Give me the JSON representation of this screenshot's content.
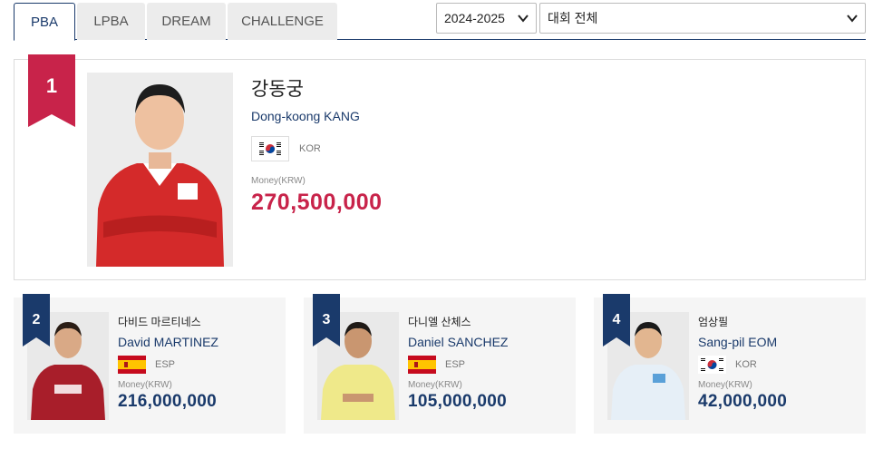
{
  "tabs": [
    {
      "label": "PBA",
      "active": true
    },
    {
      "label": "LPBA",
      "active": false
    },
    {
      "label": "DREAM",
      "active": false
    },
    {
      "label": "CHALLENGE",
      "active": false
    }
  ],
  "filters": {
    "season": "2024-2025",
    "event": "대회 전체"
  },
  "colors": {
    "accent_navy": "#1a3a6b",
    "accent_red": "#c8234a"
  },
  "top_player": {
    "rank": "1",
    "name_ko": "강동궁",
    "name_en": "Dong-koong KANG",
    "country": "KOR",
    "flag_icon": "korea-flag-icon",
    "money_label": "Money(KRW)",
    "money": "270,500,000"
  },
  "players": [
    {
      "rank": "2",
      "name_ko": "다비드 마르티네스",
      "name_en": "David MARTINEZ",
      "country": "ESP",
      "flag_icon": "spain-flag-icon",
      "money_label": "Money(KRW)",
      "money": "216,000,000"
    },
    {
      "rank": "3",
      "name_ko": "다니엘 산체스",
      "name_en": "Daniel SANCHEZ",
      "country": "ESP",
      "flag_icon": "spain-flag-icon",
      "money_label": "Money(KRW)",
      "money": "105,000,000"
    },
    {
      "rank": "4",
      "name_ko": "엄상필",
      "name_en": "Sang-pil EOM",
      "country": "KOR",
      "flag_icon": "korea-flag-icon",
      "money_label": "Money(KRW)",
      "money": "42,000,000"
    }
  ]
}
